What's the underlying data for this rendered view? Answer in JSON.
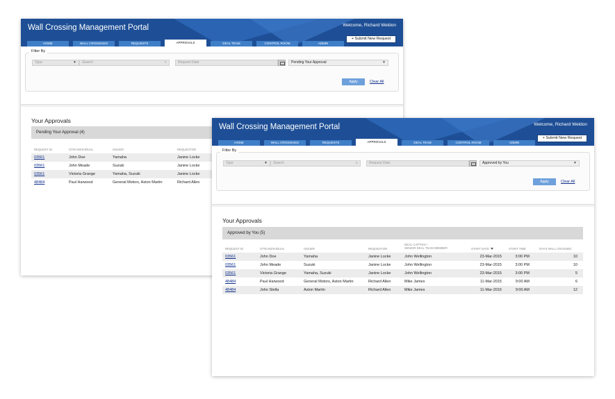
{
  "back": {
    "header": {
      "title": "Wall Crossing Management Portal",
      "welcome": "Welcome, Richard Weldon",
      "submit_label": "+ Submit New Request"
    },
    "nav": [
      {
        "label": "HOME"
      },
      {
        "label": "WALL CROSSINGS"
      },
      {
        "label": "REQUESTS"
      },
      {
        "label": "APPROVALS"
      },
      {
        "label": "DEAL TEAM"
      },
      {
        "label": "CONTROL ROOM"
      },
      {
        "label": "ADMIN"
      }
    ],
    "filter": {
      "label": "Filter By",
      "type_placeholder": "Type",
      "search_placeholder": "Search",
      "date_placeholder": "Request Date",
      "status_value": "Pending Your Approval",
      "apply_label": "Apply",
      "clear_label": "Clear All"
    },
    "section_title": "Your Approvals",
    "group_label": "Pending Your Approval (4)",
    "columns": [
      "REQUEST ID",
      "OTW INDIVIDUAL",
      "ISSUER",
      "REQUESTOR"
    ],
    "rows": [
      {
        "id": "03561",
        "individual": "John Doe",
        "issuer": "Yamaha",
        "requestor": "Janine Locke"
      },
      {
        "id": "03561",
        "individual": "John Meade",
        "issuer": "Suzuki",
        "requestor": "Janine Locke"
      },
      {
        "id": "03561",
        "individual": "Victoria Grange",
        "issuer": "Yamaha, Suzuki",
        "requestor": "Janine Locke"
      },
      {
        "id": "48484",
        "individual": "Paul Harwood",
        "issuer": "General Motors, Aston Martin",
        "requestor": "Richard Allen"
      }
    ]
  },
  "front": {
    "header": {
      "title": "Wall Crossing Management Portal",
      "welcome": "Welcome, Richard Weldon",
      "submit_label": "+ Submit New Request"
    },
    "nav": [
      {
        "label": "HOME"
      },
      {
        "label": "WALL CROSSINGS"
      },
      {
        "label": "REQUESTS"
      },
      {
        "label": "APPROVALS"
      },
      {
        "label": "DEAL TEAM"
      },
      {
        "label": "CONTROL ROOM"
      },
      {
        "label": "ADMIN"
      }
    ],
    "filter": {
      "label": "Filter By",
      "type_placeholder": "Type",
      "search_placeholder": "Search",
      "date_placeholder": "Request Date",
      "status_value": "Approved by You",
      "apply_label": "Apply",
      "clear_label": "Clear All"
    },
    "section_title": "Your Approvals",
    "group_label": "Approved by You (5)",
    "columns": {
      "request_id": "REQUEST ID",
      "individual": "OTW INDIVIDUAL",
      "issuer": "ISSUER",
      "requestor": "REQUESTOR",
      "captain_line1": "DEAL CAPTAIN /",
      "captain_line2": "SENIOR DEAL TEAM MEMBER",
      "start_date": "START DATE",
      "start_time": "START TIME",
      "days": "DAYS WALL CROSSED"
    },
    "rows": [
      {
        "id": "03561",
        "individual": "John Doe",
        "issuer": "Yamaha",
        "requestor": "Janine Locke",
        "captain": "John Wellington",
        "date": "23-Mar-2015",
        "time": "3:00 PM",
        "days": "10"
      },
      {
        "id": "03561",
        "individual": "John Meade",
        "issuer": "Suzuki",
        "requestor": "Janine Locke",
        "captain": "John Wellington",
        "date": "23-Mar-2015",
        "time": "3:00 PM",
        "days": "10"
      },
      {
        "id": "03561",
        "individual": "Victoria Grange",
        "issuer": "Yamaha, Suzuki",
        "requestor": "Janine Locke",
        "captain": "John Wellington",
        "date": "23-Mar-2015",
        "time": "3:00 PM",
        "days": "5"
      },
      {
        "id": "48484",
        "individual": "Paul Harwood",
        "issuer": "General Motors, Aston Martin",
        "requestor": "Richard Allen",
        "captain": "Mike James",
        "date": "11-Mar-2015",
        "time": "9:00 AM",
        "days": "6"
      },
      {
        "id": "48484",
        "individual": "John Stella",
        "issuer": "Aston Martin",
        "requestor": "Richard Allen",
        "captain": "Mike James",
        "date": "11-Mar-2015",
        "time": "9:00 AM",
        "days": "12"
      }
    ]
  },
  "colors": {
    "header_blue": "#1e4f96",
    "tab_blue": "#3f7fc8",
    "apply_blue": "#6ea0dc",
    "link_blue": "#0b2c8a"
  }
}
